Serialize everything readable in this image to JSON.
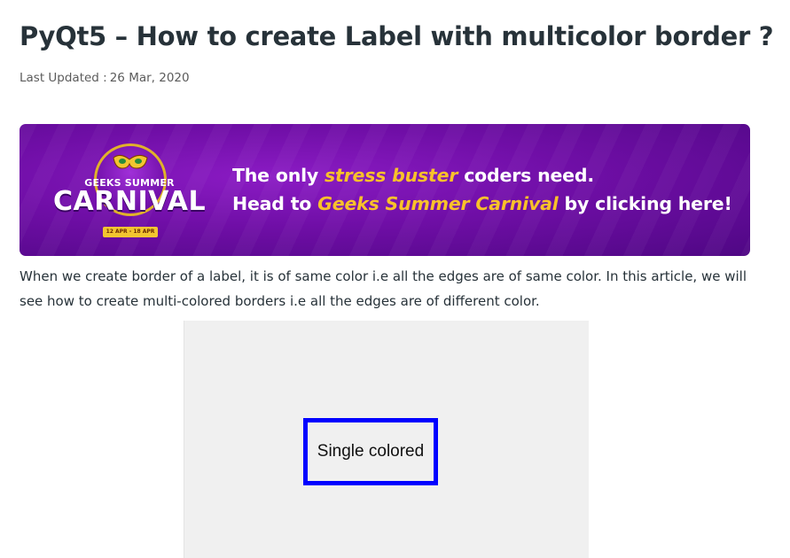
{
  "article": {
    "title": "PyQt5 – How to create Label with multicolor border ?",
    "updated_label": "Last Updated :",
    "updated_date": "26 Mar, 2020",
    "intro": "When we create border of a label, it is of same color i.e all the edges are of same color. In this article, we will see how to create multi-colored borders i.e all the edges are of different color."
  },
  "banner": {
    "logo_top": "GEEKS SUMMER",
    "logo_main": "CARNIVAL",
    "logo_dates": "12 APR - 18 APR",
    "line1_prefix": "The only ",
    "line1_highlight": "stress buster",
    "line1_suffix": " coders need.",
    "line2_prefix": "Head to ",
    "line2_highlight": "Geeks Summer Carnival",
    "line2_suffix": " by clicking here!",
    "colors": {
      "background": "#6f0ea6",
      "highlight": "#f9c12a",
      "text": "#ffffff"
    }
  },
  "demo": {
    "label_text": "Single colored",
    "border_color": "#0000ff",
    "background": "#f0f0f0"
  }
}
